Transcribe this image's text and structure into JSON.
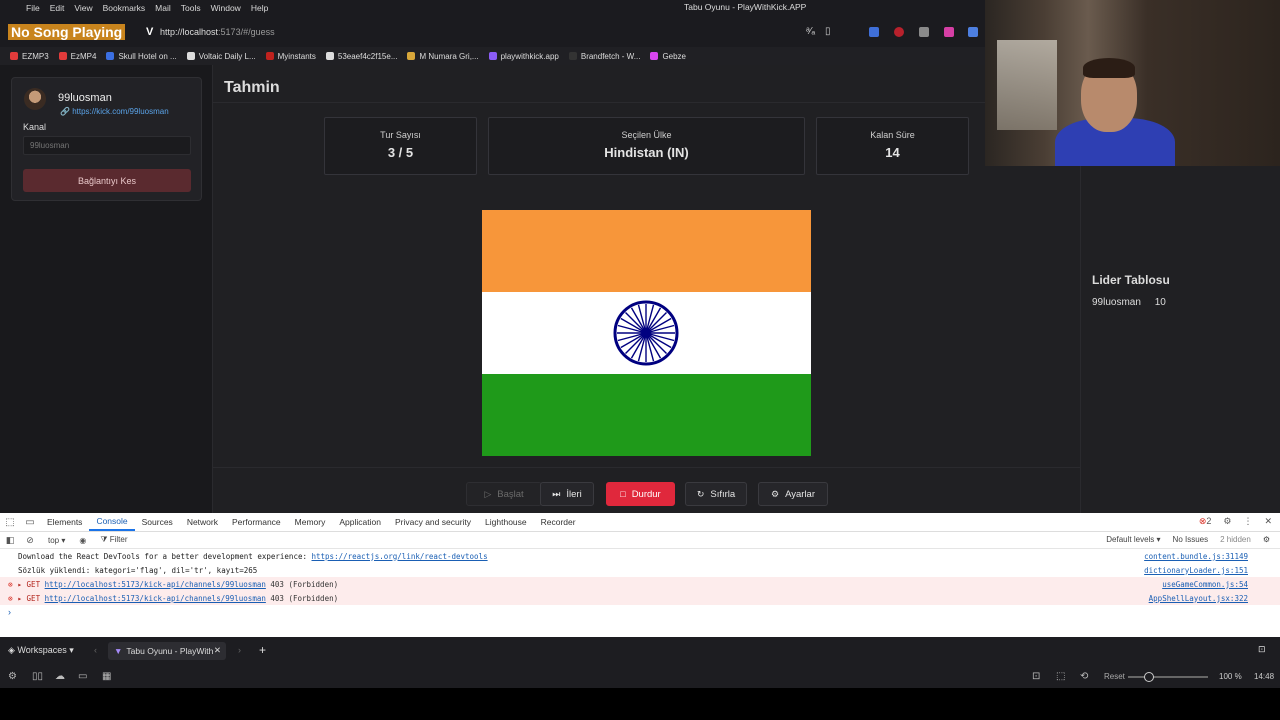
{
  "menubar": {
    "items": [
      "File",
      "Edit",
      "View",
      "Bookmarks",
      "Mail",
      "Tools",
      "Window",
      "Help"
    ],
    "window_title": "Tabu Oyunu - PlayWithKick.APP"
  },
  "addressbar": {
    "now_playing": "No Song Playing",
    "url_host": "http://localhost",
    "url_rest": ":5173/#/guess"
  },
  "bookmarks": [
    {
      "label": "EZMP3",
      "color": "#e23b3b"
    },
    {
      "label": "EzMP4",
      "color": "#e23b3b"
    },
    {
      "label": "Skull Hotel on ...",
      "color": "#3b6fe2"
    },
    {
      "label": "Voltaic Daily L...",
      "color": "#dddddd"
    },
    {
      "label": "Myinstants",
      "color": "#c0221e"
    },
    {
      "label": "53eaef4c2f15e...",
      "color": "#dddddd"
    },
    {
      "label": "M Numara Gri,...",
      "color": "#d8a73a"
    },
    {
      "label": "playwithkick.app",
      "color": "#8b5cf6"
    },
    {
      "label": "Brandfetch - W...",
      "color": "#333333"
    },
    {
      "label": "Gebze",
      "color": "#d946ef"
    }
  ],
  "user": {
    "name": "99luosman",
    "link": "https://kick.com/99luosman",
    "channel_label": "Kanal",
    "channel_placeholder": "99luosman",
    "disconnect_label": "Bağlantıyı Kes"
  },
  "main": {
    "title": "Tahmin",
    "stats": [
      {
        "label": "Tur Sayısı",
        "value": "3 / 5"
      },
      {
        "label": "Seçilen Ülke",
        "value": "Hindistan (IN)"
      },
      {
        "label": "Kalan Süre",
        "value": "14"
      }
    ],
    "flag_colors": {
      "saffron": "#f7963a",
      "white": "#ffffff",
      "green": "#1f9a1a",
      "chakra": "#000080"
    }
  },
  "controls": {
    "start": "Başlat",
    "next": "İleri",
    "stop": "Durdur",
    "reset": "Sıfırla",
    "settings": "Ayarlar"
  },
  "leaderboard": {
    "title": "Lider Tablosu",
    "rows": [
      {
        "name": "99luosman",
        "score": "10"
      }
    ]
  },
  "devtools": {
    "tabs": [
      "Elements",
      "Console",
      "Sources",
      "Network",
      "Performance",
      "Memory",
      "Application",
      "Privacy and security",
      "Lighthouse",
      "Recorder"
    ],
    "active_tab": "Console",
    "error_count": "2",
    "context": "top",
    "filter_placeholder": "Filter",
    "levels": "Default levels",
    "issues": "No Issues",
    "hidden": "2 hidden",
    "logs": [
      {
        "type": "info",
        "text": "Download the React DevTools for a better development experience: ",
        "link": "https://reactjs.org/link/react-devtools",
        "source": "content.bundle.js:31149"
      },
      {
        "type": "info",
        "text": "Sözlük yüklendi: kategori='flag', dil='tr', kayıt=265",
        "link": "",
        "source": "dictionaryLoader.js:151"
      },
      {
        "type": "error",
        "text": "▸ GET ",
        "link": "http://localhost:5173/kick-api/channels/99luosman",
        "suffix": " 403 (Forbidden)",
        "source": "useGameCommon.js:54"
      },
      {
        "type": "error",
        "text": "▸ GET ",
        "link": "http://localhost:5173/kick-api/channels/99luosman",
        "suffix": " 403 (Forbidden)",
        "source": "AppShellLayout.jsx:322"
      }
    ]
  },
  "tabbar": {
    "workspaces": "Workspaces",
    "current_tab": "Tabu Oyunu - PlayWith"
  },
  "statusbar": {
    "reset": "Reset",
    "zoom": "100 %",
    "time": "14:48"
  }
}
